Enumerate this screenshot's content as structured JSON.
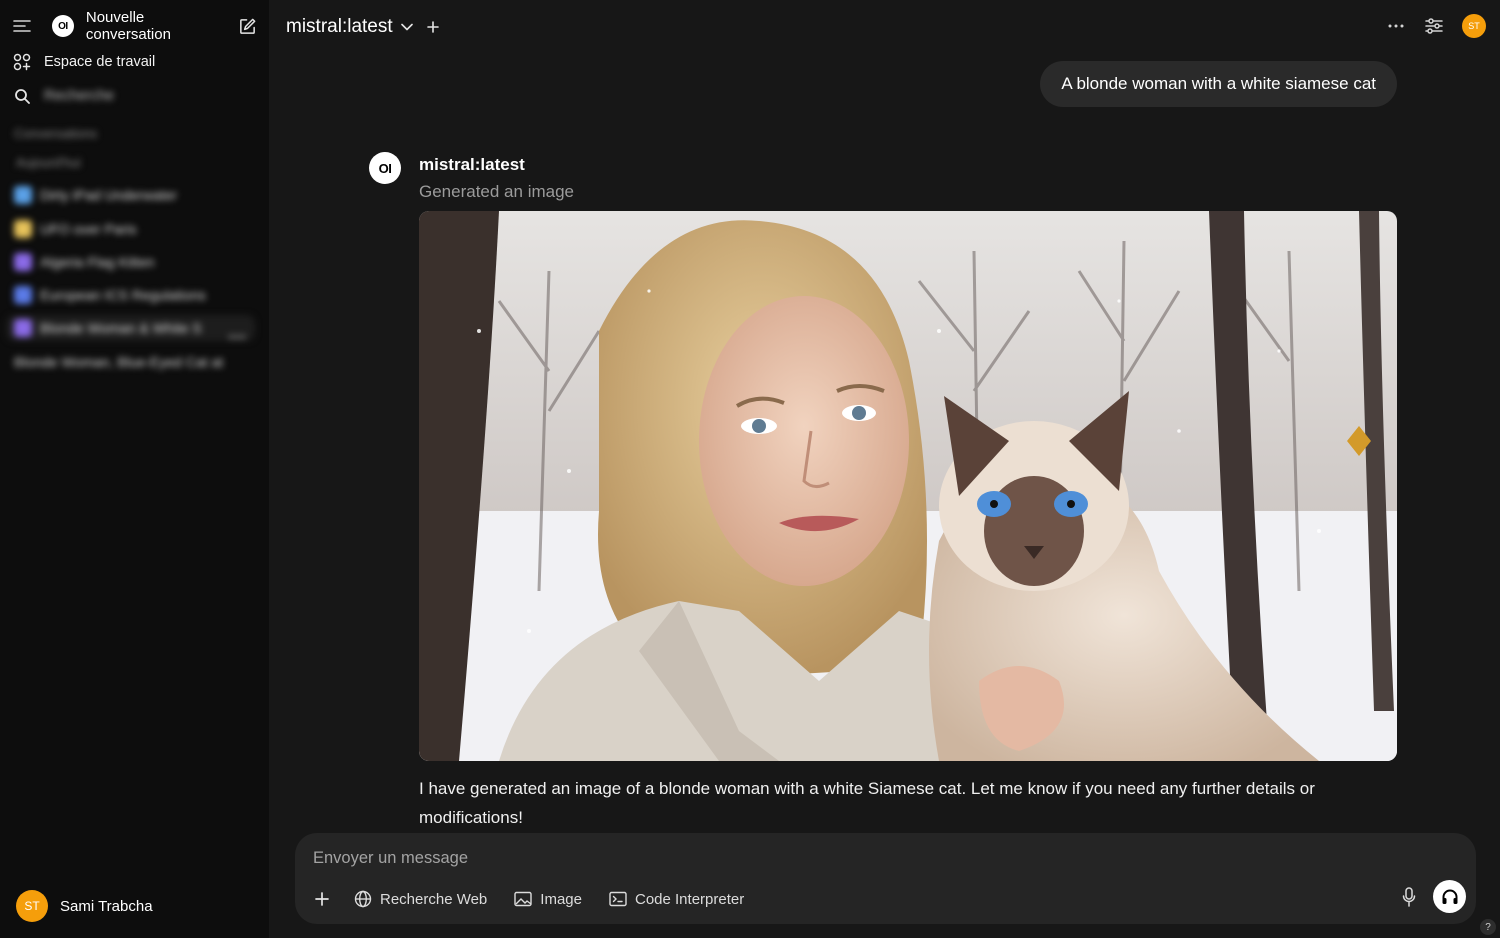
{
  "sidebar": {
    "new_chat_label": "Nouvelle conversation",
    "logo_text": "OI",
    "workspace_label": "Espace de travail",
    "search_label": "Recherche",
    "section_conversations": "Conversations",
    "section_today": "Aujourd'hui",
    "conversations": [
      {
        "title": "Dirty iPad Underwater",
        "emoji_color": "#5aa0e6"
      },
      {
        "title": "UFO over Paris",
        "emoji_color": "#e6c25a"
      },
      {
        "title": "Algeria Flag Kitten",
        "emoji_color": "#8a6ae6"
      },
      {
        "title": "European ICS Regulations",
        "emoji_color": "#5a7ae6"
      },
      {
        "title": "Blonde Woman & White S",
        "emoji_color": "#8a6ae6"
      },
      {
        "title": "Blonde Woman, Blue-Eyed Cat at",
        "emoji_color": ""
      }
    ],
    "user": {
      "initials": "ST",
      "name": "Sami Trabcha"
    }
  },
  "header": {
    "model": "mistral:latest",
    "avatar_initials": "ST"
  },
  "chat": {
    "user_message": "A blonde woman with a white siamese cat",
    "assistant": {
      "avatar_text": "OI",
      "name": "mistral:latest",
      "status": "Generated an image",
      "response": "I have generated an image of a blonde woman with a white Siamese cat. Let me know if you need any further details or modifications!"
    }
  },
  "composer": {
    "placeholder": "Envoyer un message",
    "tools": {
      "web": "Recherche Web",
      "image": "Image",
      "code": "Code Interpreter"
    },
    "help": "?"
  },
  "colors": {
    "accent_avatar": "#f59e0b",
    "background": "#171717",
    "sidebar": "#0d0d0d"
  }
}
